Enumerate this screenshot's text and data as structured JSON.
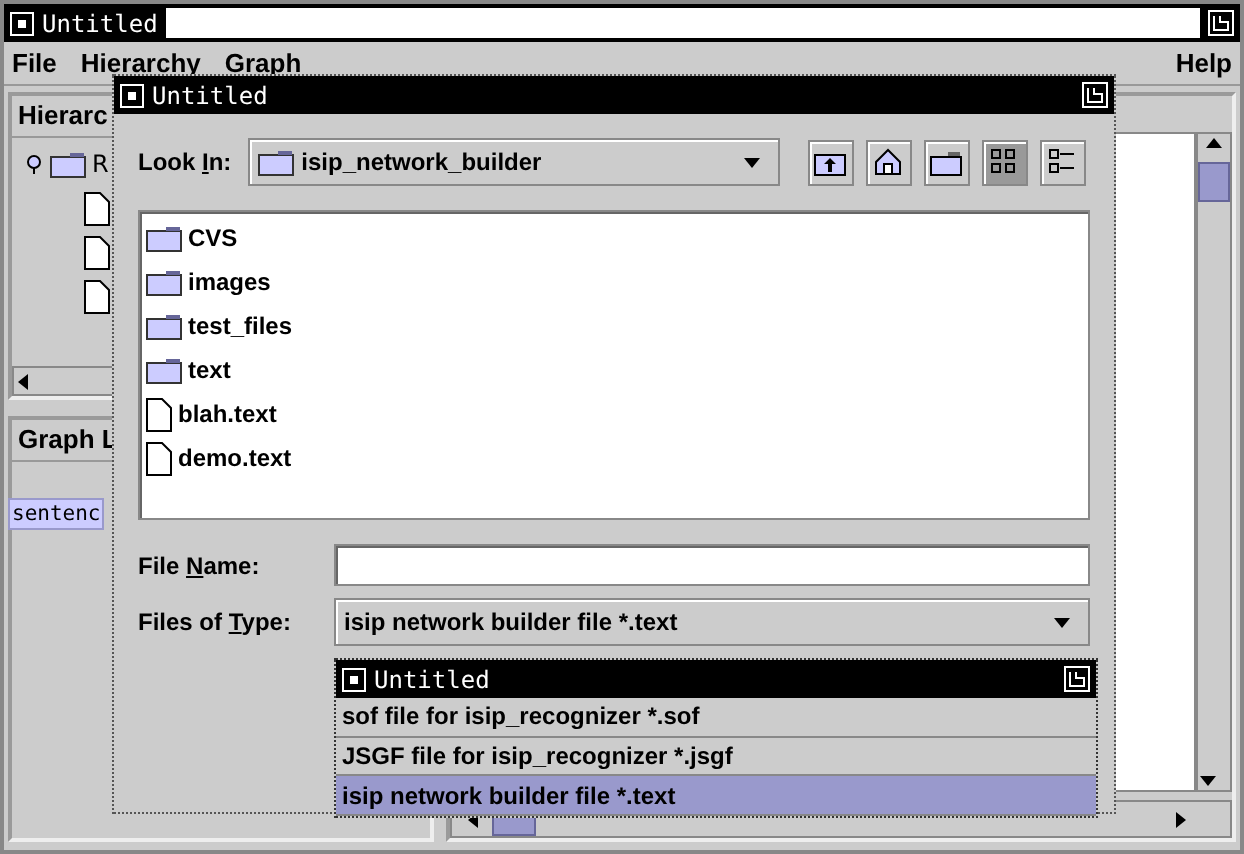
{
  "main_window": {
    "title": "Untitled"
  },
  "menu": [
    {
      "label": "File"
    },
    {
      "label": "Hierarchy"
    },
    {
      "label": "Graph"
    },
    {
      "label": "Help"
    }
  ],
  "hierarchy_panel": {
    "title": "Hierarc",
    "tree": [
      {
        "label": "R",
        "expanded": true,
        "children": [
          {
            "kind": "file"
          },
          {
            "kind": "file"
          },
          {
            "kind": "file"
          }
        ]
      }
    ]
  },
  "graph_panel": {
    "title": "Graph L",
    "items": [
      {
        "label": "sentenc",
        "selected": true
      }
    ]
  },
  "dialog": {
    "title": "Untitled",
    "look_in": {
      "label_parts": [
        "Look ",
        "I",
        "n:"
      ],
      "value": "isip_network_builder"
    },
    "toolbar": [
      {
        "kind": "up",
        "selected": false
      },
      {
        "kind": "home",
        "selected": false
      },
      {
        "kind": "new-folder",
        "selected": false
      },
      {
        "kind": "list",
        "selected": true
      },
      {
        "kind": "details",
        "selected": false
      }
    ],
    "files": [
      {
        "name": "CVS",
        "kind": "folder"
      },
      {
        "name": "images",
        "kind": "folder"
      },
      {
        "name": "test_files",
        "kind": "folder"
      },
      {
        "name": "text",
        "kind": "folder"
      },
      {
        "name": "blah.text",
        "kind": "file"
      },
      {
        "name": "demo.text",
        "kind": "file"
      }
    ],
    "file_name": {
      "label_parts": [
        "File ",
        "N",
        "ame:"
      ]
    },
    "file_type": {
      "label_parts": [
        "Files of ",
        "T",
        "ype:"
      ],
      "value": "isip network builder file *.text"
    }
  },
  "popup": {
    "title": "Untitled",
    "options": [
      {
        "label": "sof file for isip_recognizer *.sof",
        "selected": false
      },
      {
        "label": "JSGF file for isip_recognizer *.jsgf",
        "selected": false
      },
      {
        "label": "isip network builder file *.text",
        "selected": true
      }
    ]
  }
}
